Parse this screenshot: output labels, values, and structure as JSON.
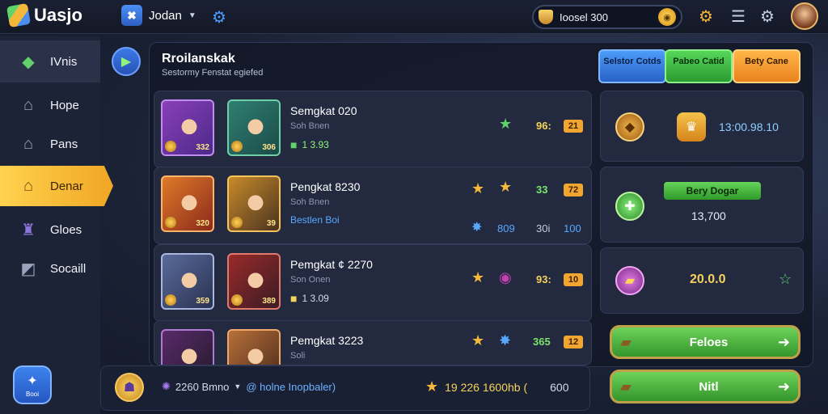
{
  "app": {
    "logo_text": "Uasjo"
  },
  "user": {
    "initial": "✖",
    "name": "Jodan"
  },
  "currency": {
    "label": "Ioosel 300",
    "coin_symbol": "◉"
  },
  "sidebar": {
    "items": [
      {
        "label": "IVnis",
        "icon": "layers-icon"
      },
      {
        "label": "Hope",
        "icon": "house-icon"
      },
      {
        "label": "Pans",
        "icon": "house-icon"
      },
      {
        "label": "Denar",
        "icon": "house-icon"
      },
      {
        "label": "Gloes",
        "icon": "castle-icon"
      },
      {
        "label": "Socaill",
        "icon": "tag-icon"
      }
    ],
    "corner_button_label": "Booi"
  },
  "panel": {
    "title": "Rroilanskak",
    "subtitle": "Sestormy Fenstat egiefed",
    "tabs": [
      {
        "label": "Selstor Cotds"
      },
      {
        "label": "Pabeo Catid"
      },
      {
        "label": "Bety Cane"
      }
    ]
  },
  "rows": [
    {
      "name": "Semgkat 020",
      "sub": "Soh Bnen",
      "info": "1 3.93",
      "star1": "",
      "star2": "★",
      "num": "96:",
      "box": "21",
      "level1": "332",
      "level2": "306"
    },
    {
      "name": "Pengkat 8230",
      "sub": "Soh Bnen",
      "info": "Bestlen Boi",
      "info2": "809",
      "info3": "30i",
      "info4": "100",
      "star1": "★",
      "star2": "★",
      "num": "33",
      "box": "72",
      "level1": "320",
      "level2": "39"
    },
    {
      "name": "Pemgkat ¢ 2270",
      "sub": "Son Onen",
      "info": "1 3.09",
      "star1": "★",
      "star2": "◉",
      "num": "93:",
      "box": "10",
      "level1": "359",
      "level2": "389"
    },
    {
      "name": "Pemgkat 3223",
      "sub": "Soli",
      "info": "",
      "star1": "★",
      "star2": "✸",
      "num": "365",
      "box": "12",
      "level1": "",
      "level2": ""
    }
  ],
  "right": {
    "r1_value": "13:00.98.10",
    "r2_ribbon": "Bery Dogar",
    "r2_value": "13,700",
    "r3_value": "20.0.0",
    "btn1": "Feloes",
    "btn2": "Nitl"
  },
  "bottom": {
    "count": "2260 Bmno",
    "link": "@ holne Inopbaler)",
    "right_text": "19 226 1600hb (",
    "right_num": "600"
  },
  "colors": {
    "accent": "#f0a624",
    "panel": "#232a40",
    "green": "#4fc14b"
  }
}
